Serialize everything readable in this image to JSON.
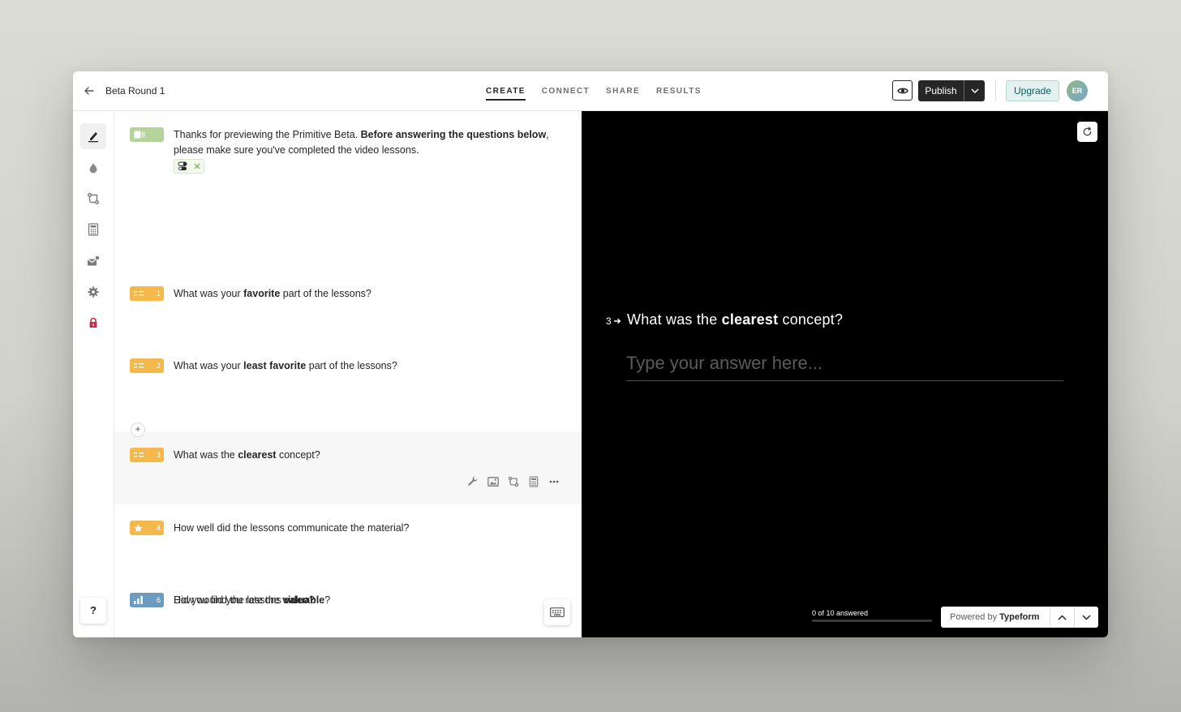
{
  "header": {
    "form_title": "Beta Round 1",
    "tabs": [
      {
        "label": "CREATE",
        "active": true
      },
      {
        "label": "CONNECT",
        "active": false
      },
      {
        "label": "SHARE",
        "active": false
      },
      {
        "label": "RESULTS",
        "active": false
      }
    ],
    "publish_label": "Publish",
    "upgrade_label": "Upgrade",
    "avatar_initials": "ER"
  },
  "sidebar": {
    "items": [
      {
        "icon": "pen-icon",
        "active": true
      },
      {
        "icon": "drop-icon",
        "active": false
      },
      {
        "icon": "logic-icon",
        "active": false
      },
      {
        "icon": "calculator-icon",
        "active": false
      },
      {
        "icon": "mail-icon",
        "active": false
      },
      {
        "icon": "gear-icon",
        "active": false
      },
      {
        "icon": "lock-icon",
        "active": false
      }
    ],
    "help_label": "?"
  },
  "questions": {
    "welcome": {
      "pre": "Thanks for previewing the Primitive Beta. ",
      "bold": "Before answering the questions below",
      "post": ", please make sure you've completed the video lessons.",
      "color": "#b5d49c"
    },
    "q1": {
      "number": "1",
      "pre": "What was your ",
      "bold": "favorite",
      "post": " part of the lessons?",
      "color": "#f5b84b"
    },
    "q2": {
      "number": "2",
      "pre": "What was your ",
      "bold": "least favorite",
      "post": " part of the lessons?",
      "color": "#f5b84b"
    },
    "q3": {
      "number": "3",
      "pre": "What was the ",
      "bold": "clearest",
      "post": " concept?",
      "color": "#f5b84b"
    },
    "q4": {
      "number": "4",
      "pre": "How well did the lessons communicate the material?",
      "bold": "",
      "post": "",
      "color": "#f5b84b"
    },
    "q5": {
      "number": "5",
      "pre": "Did you find the lessons ",
      "bold": "valuable",
      "post": "?",
      "color": "#c2314a"
    },
    "q6": {
      "number": "6",
      "pre": "How would you rate the ",
      "bold": "video",
      "post": "?",
      "color": "#6e9bc0"
    }
  },
  "add_label": "+",
  "preview": {
    "question_number": "3",
    "question_pre": "What was the ",
    "question_bold": "clearest",
    "question_post": " concept?",
    "answer_placeholder": "Type your answer here...",
    "progress_text": "0 of 10 answered",
    "progress_fraction": 0,
    "powered_by": "Powered by ",
    "powered_brand": "Typeform"
  }
}
